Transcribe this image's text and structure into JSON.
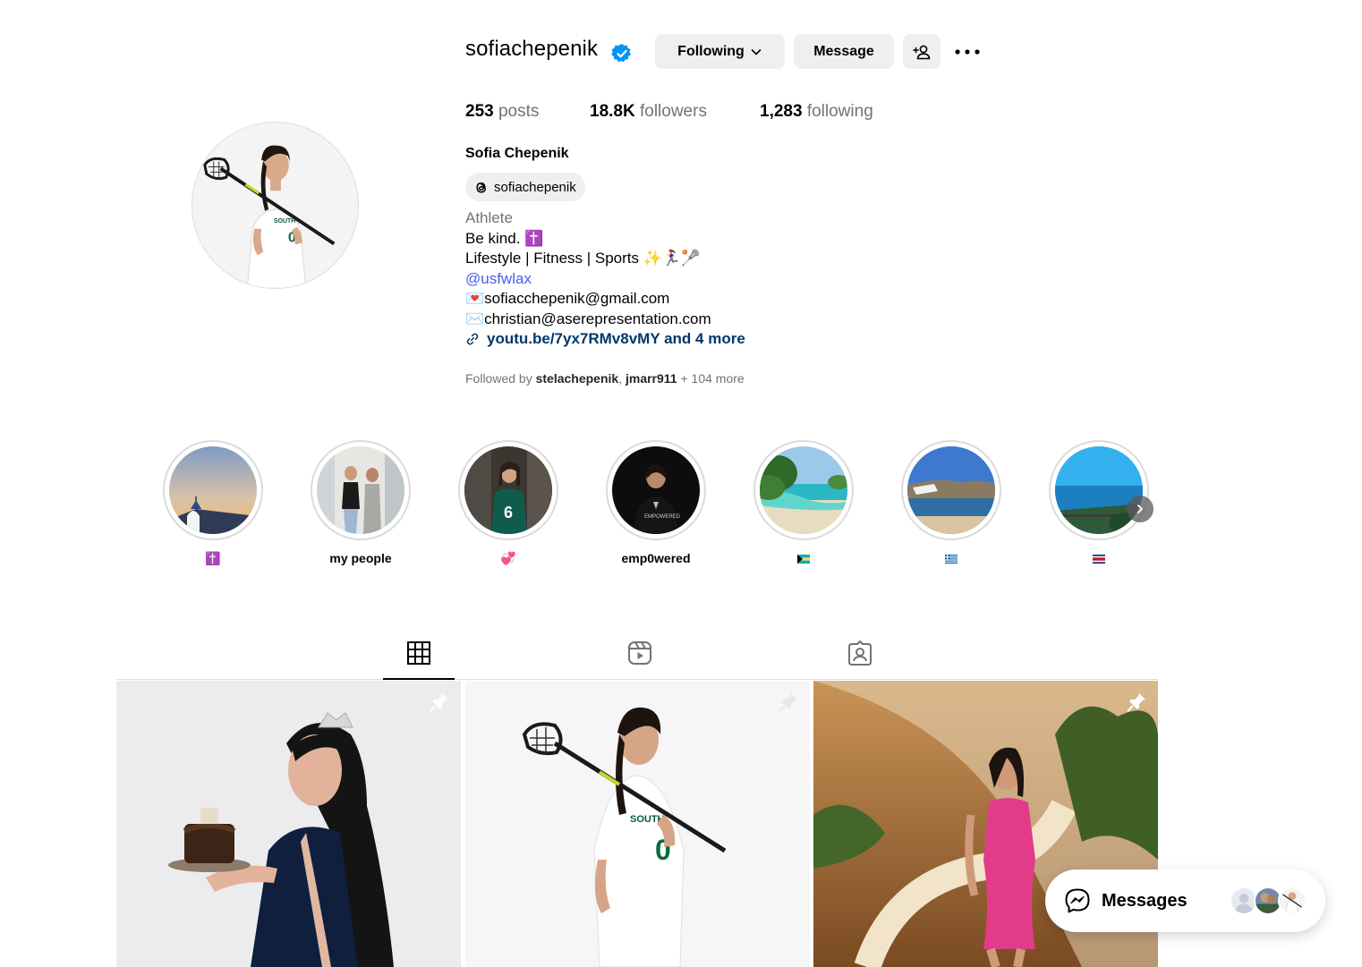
{
  "profile": {
    "username": "sofiachepenik",
    "full_name": "Sofia Chepenik",
    "threads_handle": "sofiachepenik",
    "verified": true
  },
  "actions": {
    "following_label": "Following",
    "message_label": "Message"
  },
  "stats": {
    "posts_count": "253",
    "posts_label": "posts",
    "followers_count": "18.8K",
    "followers_label": "followers",
    "following_count": "1,283",
    "following_label": "following"
  },
  "bio": {
    "category": "Athlete",
    "line1": "Be kind. ✝️",
    "line2": "Lifestyle | Fitness | Sports ✨🏃‍♀️🥍",
    "mention": "@usfwlax",
    "email1": "💌sofiacchepenik@gmail.com",
    "email2": "✉️christian@aserepresentation.com",
    "link": "youtu.be/7yx7RMv8vMY and 4 more"
  },
  "followed_by": {
    "prefix": "Followed by ",
    "user1": "stelachepenik",
    "separator": ", ",
    "user2": "jmarr911",
    "suffix": " + 104 more"
  },
  "highlights": [
    {
      "label": "✝️",
      "icon": "latin-cross-emoji"
    },
    {
      "label": "my people"
    },
    {
      "label": "💞",
      "icon": "revolving-hearts-emoji"
    },
    {
      "label": "emp0wered"
    },
    {
      "label": "",
      "icon": "bahamas-flag"
    },
    {
      "label": "",
      "icon": "greece-flag"
    },
    {
      "label": "",
      "icon": "costa-rica-flag"
    }
  ],
  "tabs": [
    {
      "name": "posts",
      "icon": "grid-icon",
      "active": true
    },
    {
      "name": "reels",
      "icon": "reels-icon",
      "active": false
    },
    {
      "name": "tagged",
      "icon": "tagged-icon",
      "active": false
    }
  ],
  "posts": [
    {
      "pinned": true,
      "subject": "birthday cake with tiara"
    },
    {
      "pinned": true,
      "subject": "lacrosse player portrait"
    },
    {
      "pinned": true,
      "subject": "pink dress on staircase"
    }
  ],
  "messages": {
    "label": "Messages"
  },
  "colors": {
    "link": "#00376b",
    "mention": "#4a5cf0",
    "verified": "#0095f6",
    "button_bg": "#efefef",
    "muted": "#737373"
  }
}
